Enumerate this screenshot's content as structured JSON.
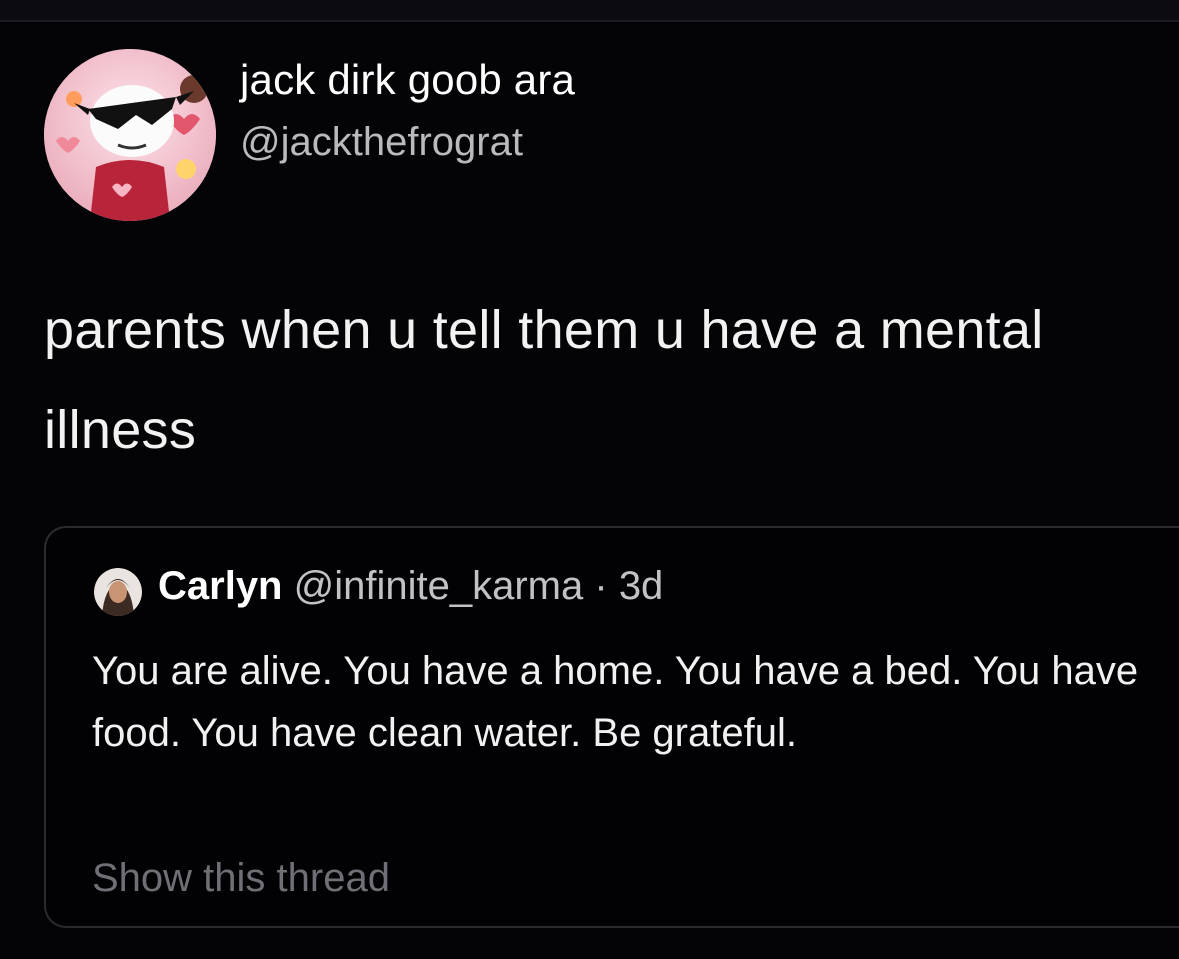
{
  "tweet": {
    "author": {
      "display_name": "jack dirk goob ara",
      "handle": "@jackthefrograt"
    },
    "text": "parents when u tell them u have a mental illness"
  },
  "quoted_tweet": {
    "author": {
      "display_name": "Carlyn",
      "handle": "@infinite_karma",
      "separator": "·",
      "time": "3d"
    },
    "text": "You are alive. You have a home. You have a bed. You have food. You have clean water. Be grateful.",
    "show_thread_label": "Show this thread"
  },
  "colors": {
    "background": "#040407",
    "primary_text": "#ffffff",
    "secondary_text": "#b9b9be",
    "muted_link": "#6f6f75",
    "card_border": "#2a2a31"
  },
  "icons": {
    "author_avatar": "profile-avatar-cartoon",
    "quoted_avatar": "profile-avatar-photo"
  }
}
